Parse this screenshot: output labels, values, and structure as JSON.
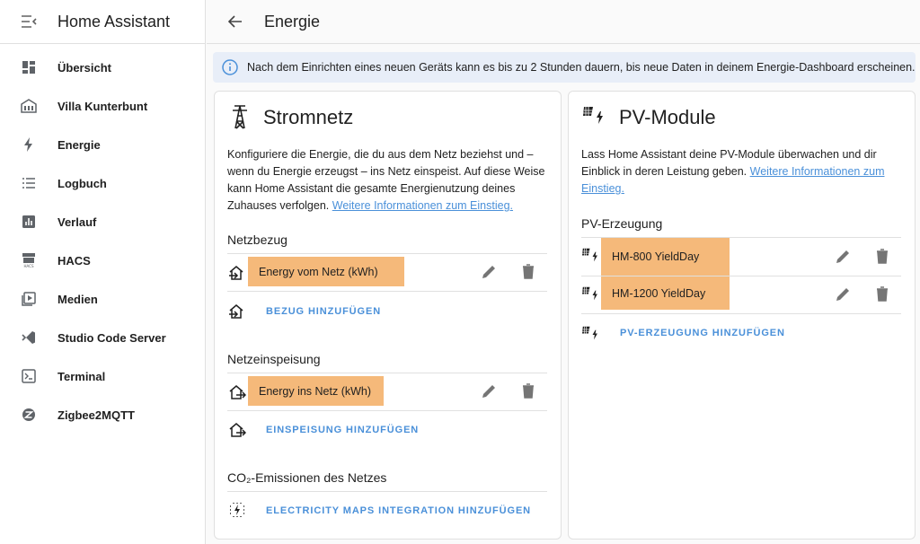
{
  "sidebar": {
    "title": "Home Assistant",
    "items": [
      {
        "label": "Übersicht",
        "icon": "dashboard-icon"
      },
      {
        "label": "Villa Kunterbunt",
        "icon": "home-icon"
      },
      {
        "label": "Energie",
        "icon": "lightning-icon"
      },
      {
        "label": "Logbuch",
        "icon": "list-icon"
      },
      {
        "label": "Verlauf",
        "icon": "chart-icon"
      },
      {
        "label": "HACS",
        "icon": "hacs-icon"
      },
      {
        "label": "Medien",
        "icon": "media-icon"
      },
      {
        "label": "Studio Code Server",
        "icon": "vscode-icon"
      },
      {
        "label": "Terminal",
        "icon": "terminal-icon"
      },
      {
        "label": "Zigbee2MQTT",
        "icon": "zigbee-icon"
      }
    ]
  },
  "header": {
    "title": "Energie"
  },
  "info": {
    "text": "Nach dem Einrichten eines neuen Geräts kann es bis zu 2 Stunden dauern, bis neue Daten in deinem Energie-Dashboard erscheinen."
  },
  "grid": {
    "title": "Stromnetz",
    "description": "Konfiguriere die Energie, die du aus dem Netz beziehst und – wenn du Energie erzeugst – ins Netz einspeist. Auf diese Weise kann Home Assistant die gesamte Energienutzung deines Zuhauses verfolgen.",
    "link": "Weitere Informationen zum Einstieg.",
    "consumption": {
      "title": "Netzbezug",
      "entity": "Energy vom Netz (kWh)",
      "add_label": "BEZUG HINZUFÜGEN"
    },
    "return": {
      "title": "Netzeinspeisung",
      "entity": "Energy ins Netz (kWh)",
      "add_label": "EINSPEISUNG HINZUFÜGEN"
    },
    "co2": {
      "title": "CO₂-Emissionen des Netzes",
      "add_label": "ELECTRICITY MAPS INTEGRATION HINZUFÜGEN"
    }
  },
  "solar": {
    "title": "PV-Module",
    "description": "Lass Home Assistant deine PV-Module überwachen und dir Einblick in deren Leistung geben.",
    "link": "Weitere Informationen zum Einstieg.",
    "section_title": "PV-Erzeugung",
    "entities": [
      "HM-800 YieldDay",
      "HM-1200 YieldDay"
    ],
    "add_label": "PV-ERZEUGUNG HINZUFÜGEN"
  },
  "colors": {
    "accent": "#4a90d9",
    "highlight": "#f5b97a",
    "info_bg": "#e8eef8"
  }
}
